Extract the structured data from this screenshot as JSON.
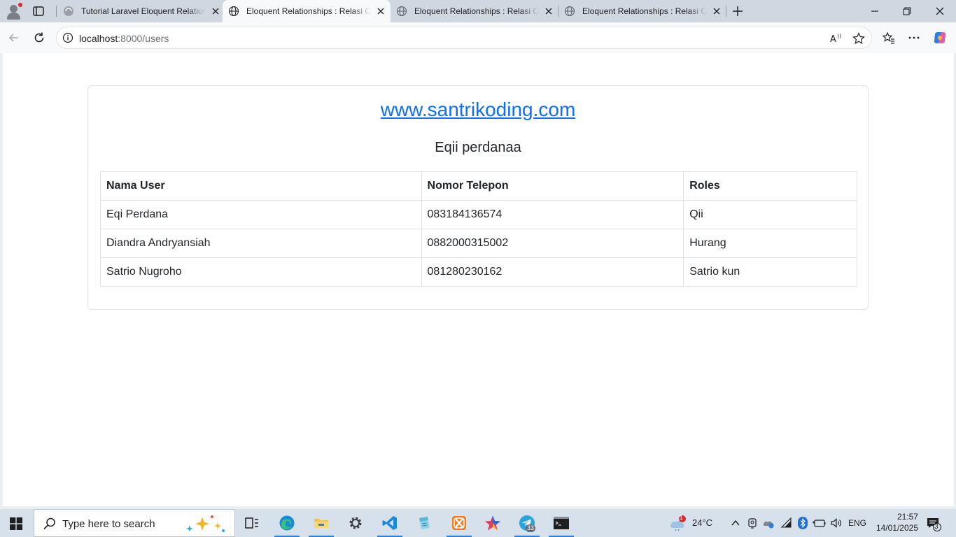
{
  "browser": {
    "tabs": [
      {
        "title": "Tutorial Laravel Eloquent Relation",
        "active": false
      },
      {
        "title": "Eloquent Relationships : Relasi On",
        "active": true
      },
      {
        "title": "Eloquent Relationships : Relasi On",
        "active": false
      },
      {
        "title": "Eloquent Relationships : Relasi On",
        "active": false
      }
    ],
    "address": {
      "host": "localhost",
      "rest": ":8000/users"
    }
  },
  "page": {
    "site_link": "www.santrikoding.com",
    "subtitle": "Eqii perdanaa",
    "table": {
      "headers": [
        "Nama User",
        "Nomor Telepon",
        "Roles"
      ],
      "rows": [
        [
          "Eqi Perdana",
          "083184136574",
          "Qii"
        ],
        [
          "Diandra Andryansiah",
          "0882000315002",
          "Hurang"
        ],
        [
          "Satrio Nugroho",
          "081280230162",
          "Satrio kun"
        ]
      ]
    }
  },
  "taskbar": {
    "search_placeholder": "Type here to search",
    "weather": {
      "temp": "24°C",
      "badge": "1"
    },
    "language": "ENG",
    "time": "21:57",
    "date": "14/01/2025",
    "notification_count": "3",
    "telegram_badge": "33"
  },
  "colors": {
    "link": "#0d6efd",
    "accent": "#2e7dd7"
  }
}
